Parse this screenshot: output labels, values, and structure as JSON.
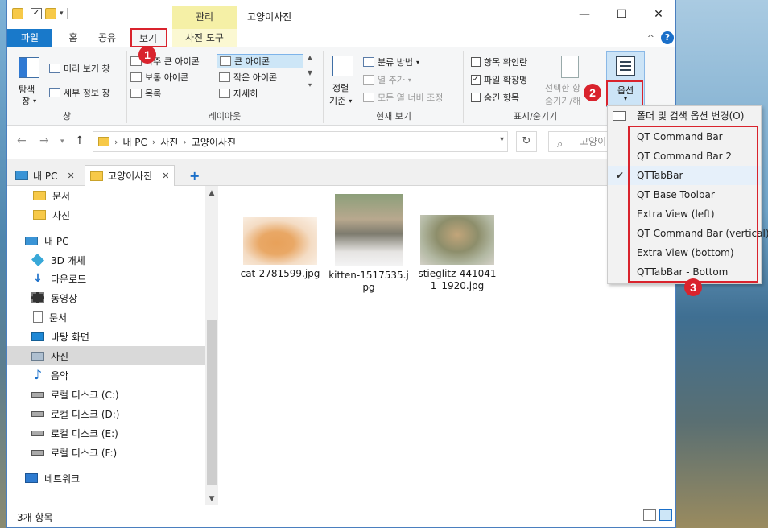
{
  "titlebar": {
    "context_tab": "관리",
    "title": "고양이사진",
    "minimize": "—",
    "maximize": "☐",
    "close": "✕"
  },
  "tabs": {
    "file": "파일",
    "home": "홈",
    "share": "공유",
    "view": "보기",
    "photo_tools": "사진 도구",
    "collapse": "^",
    "help": "?"
  },
  "ribbon": {
    "pane": {
      "nav_pane": "탐색",
      "nav_pane2": "창",
      "preview": "미리 보기 창",
      "details": "세부 정보 창",
      "label": "창"
    },
    "layout": {
      "extra_large": "아주 큰 아이콘",
      "large": "큰 아이콘",
      "medium": "보통 아이콘",
      "small": "작은 아이콘",
      "list": "목록",
      "details": "자세히",
      "label": "레이아웃"
    },
    "current_view": {
      "sort1": "정렬",
      "sort2": "기준",
      "group_by": "분류 방법",
      "add_columns": "열 추가",
      "size_columns": "모든 열 너비 조정",
      "label": "현재 보기"
    },
    "show_hide": {
      "item_checkboxes": "항목 확인란",
      "file_ext": "파일 확장명",
      "hidden_items": "숨긴 항목",
      "hide_selected1": "선택한 항",
      "hide_selected2": "숨기기/해",
      "label": "표시/숨기기"
    },
    "options": {
      "label": "옵션"
    }
  },
  "annotations": {
    "b1": "1",
    "b2": "2",
    "b3": "3"
  },
  "address": {
    "crumb1": "내 PC",
    "crumb2": "사진",
    "crumb3": "고양이사진",
    "search_placeholder": "고양이"
  },
  "qttabs": {
    "tab1": "내 PC",
    "tab2": "고양이사진",
    "close": "✕",
    "add": "+"
  },
  "navtree": [
    {
      "label": "문서",
      "icon": "folder-icon"
    },
    {
      "label": "사진",
      "icon": "folder-icon"
    },
    {
      "label": "내 PC",
      "icon": "pc-icon"
    },
    {
      "label": "3D 개체",
      "icon": "cube-icon"
    },
    {
      "label": "다운로드",
      "icon": "download-icon"
    },
    {
      "label": "동영상",
      "icon": "video-icon"
    },
    {
      "label": "문서",
      "icon": "document-icon"
    },
    {
      "label": "바탕 화면",
      "icon": "desktop-icon"
    },
    {
      "label": "사진",
      "icon": "pictures-icon"
    },
    {
      "label": "음악",
      "icon": "music-icon"
    },
    {
      "label": "로컬 디스크 (C:)",
      "icon": "disk-icon"
    },
    {
      "label": "로컬 디스크 (D:)",
      "icon": "disk-icon"
    },
    {
      "label": "로컬 디스크 (E:)",
      "icon": "disk-icon"
    },
    {
      "label": "로컬 디스크 (F:)",
      "icon": "disk-icon"
    },
    {
      "label": "네트워크",
      "icon": "network-icon"
    }
  ],
  "files": [
    {
      "name1": "cat-2781599.jpg",
      "name2": ""
    },
    {
      "name1": "kitten-1517535.j",
      "name2": "pg"
    },
    {
      "name1": "stieglitz-441041",
      "name2": "1_1920.jpg"
    }
  ],
  "status": {
    "count": "3개 항목"
  },
  "menu": {
    "folder_options": "폴더 및 검색 옵션 변경(O)",
    "items": [
      {
        "label": "QT Command Bar",
        "checked": false
      },
      {
        "label": "QT Command Bar 2",
        "checked": false
      },
      {
        "label": "QTTabBar",
        "checked": true
      },
      {
        "label": "QT Base Toolbar",
        "checked": false
      },
      {
        "label": "Extra View (left)",
        "checked": false
      },
      {
        "label": "QT Command Bar (vertical)",
        "checked": false
      },
      {
        "label": "Extra View (bottom)",
        "checked": false
      },
      {
        "label": "QTTabBar - Bottom",
        "checked": false
      }
    ]
  },
  "colors": {
    "file_tab": "#1979ca",
    "annotation_red": "#d9232d",
    "context_tab": "#f5f0a6"
  }
}
